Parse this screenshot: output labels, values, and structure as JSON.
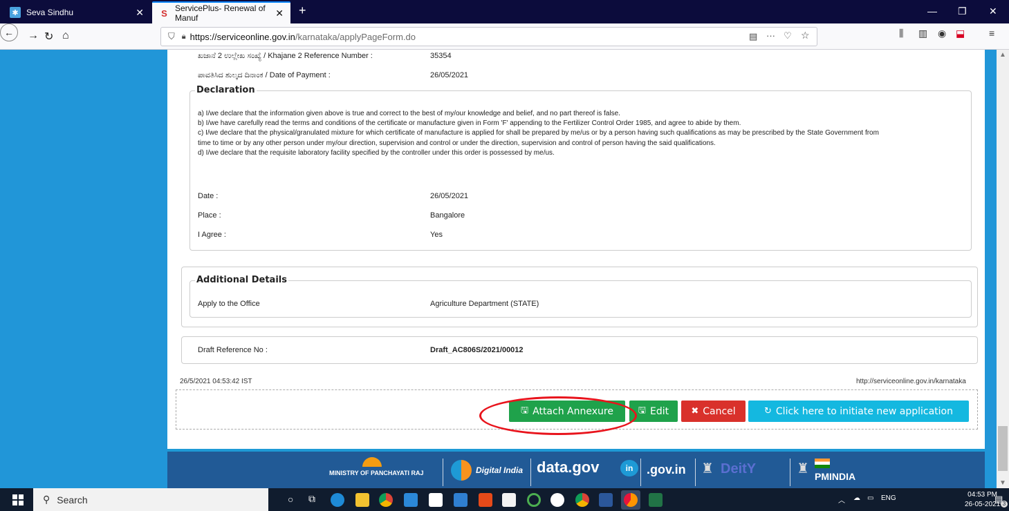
{
  "browser": {
    "tabs": [
      {
        "title": "Seva Sindhu"
      },
      {
        "title": "ServicePlus- Renewal of Manuf"
      }
    ],
    "url_base": "https://serviceonline.gov.in",
    "url_path": "/karnataka/applyPageForm.do"
  },
  "payment": {
    "khajane_label": "ಖಜಾನೆ 2 ಉಲ್ಲೇಖ ಸಂಖ್ಯೆ / Khajane 2 Reference Number :",
    "khajane_value": "35354",
    "date_label": "ಪಾವತಿಸಿದ ಶುಲ್ಕದ ದಿನಾಂಕ / Date of Payment :",
    "date_value": "26/05/2021"
  },
  "declaration": {
    "title": "Declaration",
    "a": "a)  I/we declare that the information given above is true and correct to the best of my/our knowledge and belief, and no part thereof is false.",
    "b": "b)  I/we have carefully read the terms and conditions of the certificate or manufacture given in Form 'F' appending to the Fertilizer Control Order 1985, and agree to abide by them.",
    "c1": "c)  I/we declare that the physical/granulated mixture for which certificate of manufacture is applied for shall be prepared by me/us or by a person having such qualifications as may be prescribed by the State Government from",
    "c2": "time to time or by any other person under my/our direction, supervision and control or under the direction, supervision and control of person having the said qualifications.",
    "d": "d)  I/we declare that the requisite laboratory facility specified by the controller under this order is possessed by me/us.",
    "date_label": "Date :",
    "date_value": "26/05/2021",
    "place_label": "Place :",
    "place_value": "Bangalore",
    "agree_label": "I Agree :",
    "agree_value": "Yes"
  },
  "additional": {
    "title": "Additional Details",
    "office_label": "Apply to the Office",
    "office_value": "Agriculture Department (STATE)"
  },
  "draft": {
    "label": "Draft Reference No :",
    "value": "Draft_AC806S/2021/00012"
  },
  "timestamp": "26/5/2021 04:53:42 IST",
  "site_url": "http://serviceonline.gov.in/karnataka",
  "buttons": {
    "attach": "Attach Annexure",
    "edit": "Edit",
    "cancel": "Cancel",
    "new_app": "Click here to initiate new application"
  },
  "footer": {
    "panchayat": "MINISTRY OF PANCHAYATI RAJ",
    "digital": "Digital India",
    "datagov": "data.gov",
    "indiagov": ".gov.in",
    "deity": "DeitY",
    "pmindia": "PMINDIA"
  },
  "taskbar": {
    "search": "Search",
    "lang": "ENG",
    "time": "04:53 PM",
    "date": "26-05-2021",
    "notif_count": "3"
  },
  "colors": {
    "sidebar_blue": "#2196d8",
    "success": "#1fa24b",
    "danger": "#d9312b",
    "info": "#14b8e0",
    "highlight": "#e8141c",
    "footer_blue": "#215a96"
  }
}
